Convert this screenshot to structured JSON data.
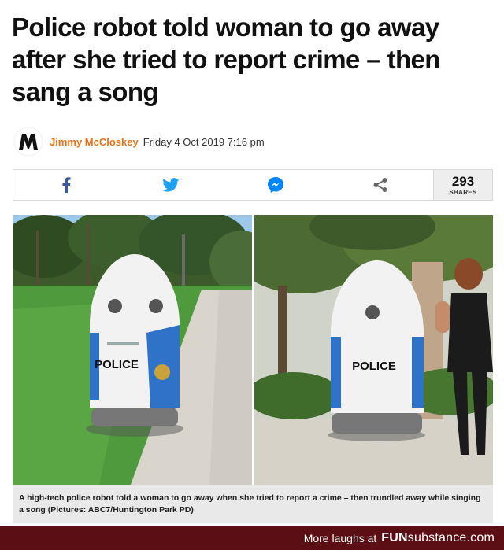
{
  "article": {
    "headline": "Police robot told woman to go away after she tried to report crime – then sang a song",
    "author": "Jimmy McCloskey",
    "date": "Friday 4 Oct 2019 7:16 pm"
  },
  "share": {
    "icons": [
      "facebook-icon",
      "twitter-icon",
      "messenger-icon",
      "share-icon"
    ],
    "count": "293",
    "count_label": "SHARES"
  },
  "images": {
    "left_robot_text": "POLICE",
    "right_robot_text": "POLICE",
    "caption": "A high-tech police robot told a woman to go away when she tried to report a crime – then trundled away while singing a song (Pictures: ABC7/Huntington Park PD)"
  },
  "footer": {
    "more_text": "More laughs at",
    "brand_bold": "FUN",
    "brand_rest": "substance.com"
  },
  "colors": {
    "author": "#e2731b",
    "facebook": "#3b5998",
    "twitter": "#1da1f2",
    "messenger": "#0084ff",
    "footer_bg": "#5b0f14",
    "robot_blue": "#2f73c9"
  }
}
